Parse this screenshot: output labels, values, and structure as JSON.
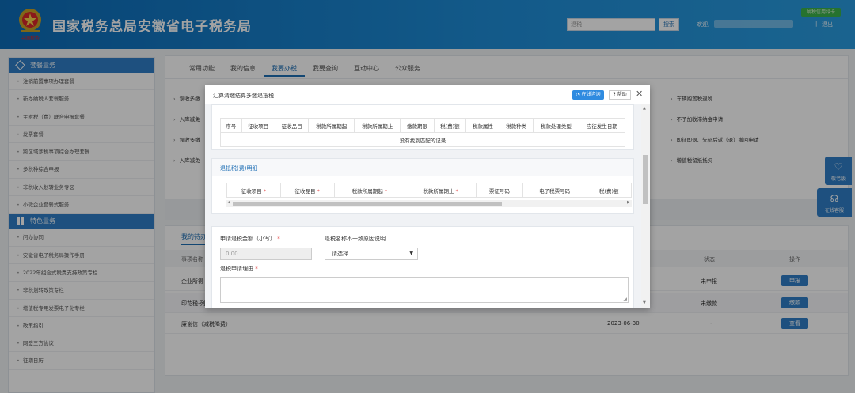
{
  "header": {
    "site_title": "国家税务总局安徽省电子税务局",
    "emblem_caption": "中国税务",
    "search_placeholder": "退税",
    "search_button": "搜索",
    "welcome": "欢迎,",
    "logout": "退出",
    "separator": "|",
    "tax_card_badge": "纳税信用绿卡",
    "brand_color": "#1578c6"
  },
  "sidebar": {
    "section1_title": "套餐业务",
    "section1_items": [
      "注销前置事项办理套餐",
      "新办纳税人套餐服务",
      "主附税（费）联合申报套餐",
      "发票套餐",
      "跨区域涉税事项综合办理套餐",
      "多税种综合申报",
      "非税收入划转业务专区",
      "小微企业套餐式服务"
    ],
    "section2_title": "特色业务",
    "section2_items": [
      "问办协同",
      "安徽省电子税务局操作手册",
      "2022年组合式税费支持政策专栏",
      "非税划转政策专栏",
      "增值税专用发票电子化专栏",
      "政策指引",
      "网签三方协议",
      "征期日历"
    ]
  },
  "main": {
    "tabs": [
      "常用功能",
      "我的信息",
      "我要办税",
      "我要查询",
      "互动中心",
      "公众服务"
    ],
    "active_tab": "我要办税",
    "services_left": [
      "误收多缴",
      "入库减免",
      "误收多缴",
      "入库减免"
    ],
    "services_right": [
      "车辆购置税退税",
      "不予加收滞纳金申请",
      "即征即退、先征后返（退）撤回申请",
      "增值税留抵抵欠"
    ]
  },
  "tasks": {
    "tab_label": "我的待办",
    "columns": {
      "name": "事项名称",
      "status": "状态",
      "action": "操作"
    },
    "rows": [
      {
        "name": "企业所得",
        "date": "",
        "status": "未申报",
        "action": "申报"
      },
      {
        "name": "印花税-列",
        "date": "",
        "status": "未缴款",
        "action": "缴款"
      },
      {
        "name": "廉谢信（减税降费）",
        "date": "2023-06-30",
        "status": "-",
        "action": "查看"
      }
    ]
  },
  "float_buttons": {
    "elder": "敬老版",
    "online": "在线客服"
  },
  "modal": {
    "title": "汇算清缴结算多缴退抵税",
    "online_consult": "在线咨询",
    "help": "帮助",
    "close": "✕",
    "table1": {
      "headers": [
        "序号",
        "征收项目",
        "征收品目",
        "税款所属期起",
        "税款所属期止",
        "缴款期限",
        "税(费)额",
        "税款属性",
        "税款种类",
        "税款处理类型",
        "应征发生日期"
      ],
      "empty_text": "没有找到匹配的记录"
    },
    "section2_title": "退抵税(费)明细",
    "table2": {
      "headers": [
        "征收项目",
        "征收品目",
        "税款所属期起",
        "税款所属期止",
        "票证号码",
        "电子税票号码",
        "税(费)额"
      ],
      "required": [
        "*",
        "*",
        "*",
        "*",
        "",
        "",
        ""
      ]
    },
    "form": {
      "amount_label": "申请退税金额（小写）",
      "amount_value": "0.00",
      "reason_label": "退税名称不一致原因说明",
      "reason_placeholder": "请选择",
      "reason_text_label": "退税申请理由",
      "required_mark": "*"
    }
  }
}
